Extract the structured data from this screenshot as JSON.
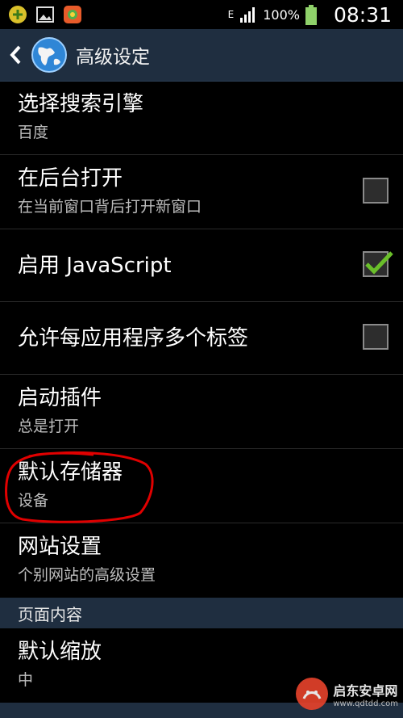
{
  "status_bar": {
    "battery_percent": "100%",
    "time": "08:31",
    "network_label": "E"
  },
  "action_bar": {
    "title": "高级设定"
  },
  "settings": [
    {
      "title": "选择搜索引擎",
      "summary": "百度"
    },
    {
      "title": "在后台打开",
      "summary": "在当前窗口背后打开新窗口",
      "checked": false
    },
    {
      "title": "启用 JavaScript",
      "checked": true
    },
    {
      "title": "允许每应用程序多个标签",
      "checked": false
    },
    {
      "title": "启动插件",
      "summary": "总是打开"
    },
    {
      "title": "默认存储器",
      "summary": "设备"
    },
    {
      "title": "网站设置",
      "summary": "个别网站的高级设置"
    }
  ],
  "section_header": "页面内容",
  "default_zoom": {
    "title": "默认缩放",
    "summary": "中"
  },
  "watermark": {
    "main": "启东安卓网",
    "sub": "www.qdtdd.com"
  },
  "colors": {
    "action_bar_bg": "#1f2e40",
    "checkmark": "#6abf2a",
    "highlight_circle": "#e00000"
  }
}
